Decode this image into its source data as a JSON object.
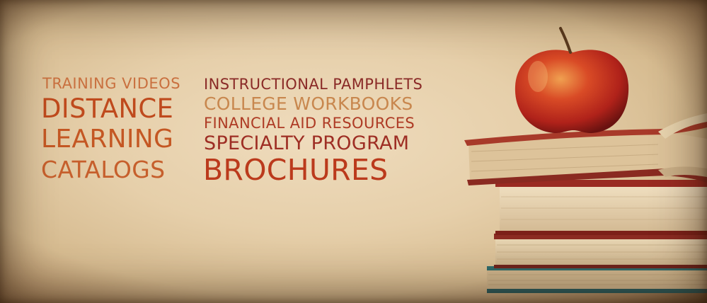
{
  "banner": {
    "words": {
      "training_videos": "TRAINING VIDEOS",
      "distance": "DISTANCE",
      "learning": "LEARNING",
      "catalogs": "CATALOGS",
      "instructional_pamphlets": "INSTRUCTIONAL PAMPHLETS",
      "college_workbooks": "COLLEGE WORKBOOKS",
      "financial_aid_resources": "FINANCIAL AID RESOURCES",
      "specialty_program": "SPECIALTY PROGRAM",
      "brochures": "BROCHURES"
    },
    "illustration": {
      "subject": "apple-on-book-stack-icon"
    },
    "colors": {
      "parchment": "#e6cfaa",
      "orange_text": "#c45723",
      "red_text": "#9e2e24",
      "apple_red": "#c0281c"
    }
  }
}
